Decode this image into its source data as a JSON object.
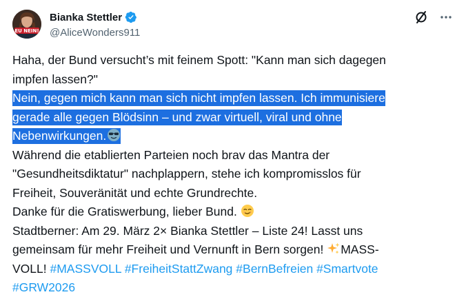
{
  "author": {
    "display_name": "Bianka Stettler",
    "handle": "@AliceWonders911",
    "avatar_text": "EU NEIN!",
    "verified_color": "#1d9bf0"
  },
  "actions": {
    "grok_icon": "grok-icon",
    "more_icon": "more-options-icon"
  },
  "tweet": {
    "line1": "Haha, der Bund versucht’s mit feinem Spott: \"Kann man sich dagegen",
    "line2": "impfen lassen?\"",
    "hl_line1": "Nein, gegen mich kann man sich nicht impfen lassen. Ich immunisiere",
    "hl_line2": "gerade alle gegen Blödsinn – und zwar virtuell, viral und ohne",
    "hl_line3": "Nebenwirkungen.",
    "line6": "Während die etablierten Parteien noch brav das Mantra der",
    "line7": "\"Gesundheitsdiktatur\" nachplappern, stehe ich kompromisslos für",
    "line8": "Freiheit, Souveränität und echte Grundrechte.",
    "line9": "Danke für die Gratiswerbung, lieber Bund.",
    "line10": "Stadtberner: Am 29. März 2× Bianka Stettler – Liste 24! Lasst uns",
    "line11": "gemeinsam für mehr Freiheit und Vernunft in Bern sorgen!",
    "line11_tail": "MASS-",
    "line12_head": "VOLL!",
    "hashtags": [
      "#MASSVOLL",
      "#FreiheitStattZwang",
      "#BernBefreien",
      "#Smartvote",
      "#GRW2026"
    ]
  },
  "colors": {
    "highlight": "#1d6fe0",
    "link": "#1d9bf0",
    "text": "#0f1419",
    "muted": "#536471"
  }
}
